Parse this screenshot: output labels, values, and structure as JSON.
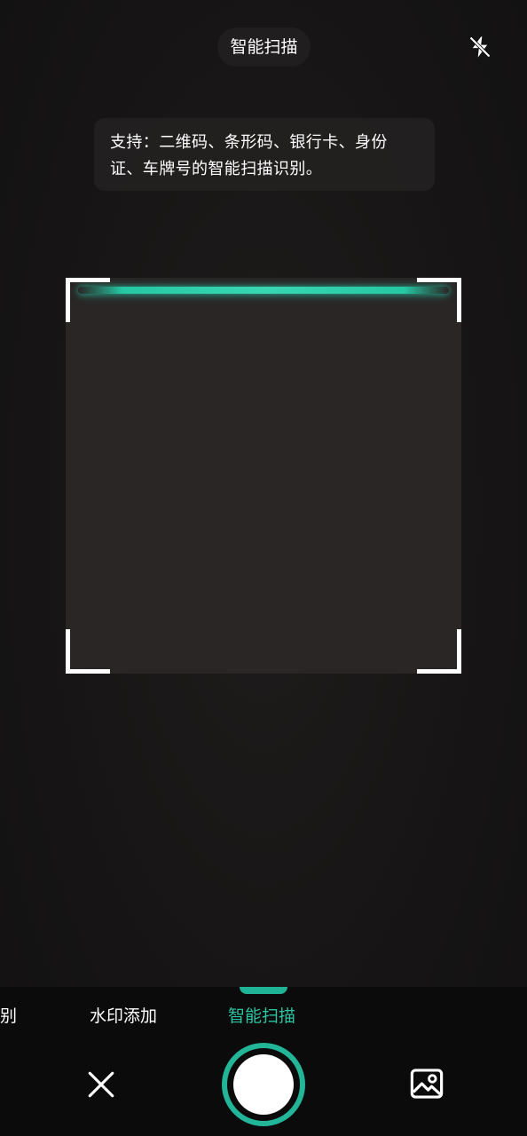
{
  "header": {
    "title": "智能扫描",
    "flash_icon": "flash-off-icon"
  },
  "hint": {
    "text": "支持：二维码、条形码、银行卡、身份证、车牌号的智能扫描识别。"
  },
  "scanner": {
    "accent_color": "#26c7a4",
    "frame_color": "#ffffff"
  },
  "modes": {
    "items": [
      {
        "label": "识别"
      },
      {
        "label": "水印添加"
      },
      {
        "label": "智能扫描"
      }
    ],
    "active_index": 2,
    "active_color": "#2cc3a2"
  },
  "controls": {
    "close_icon": "close-icon",
    "shutter_icon": "shutter-icon",
    "gallery_icon": "gallery-icon",
    "shutter_ring_color": "#22b597"
  }
}
